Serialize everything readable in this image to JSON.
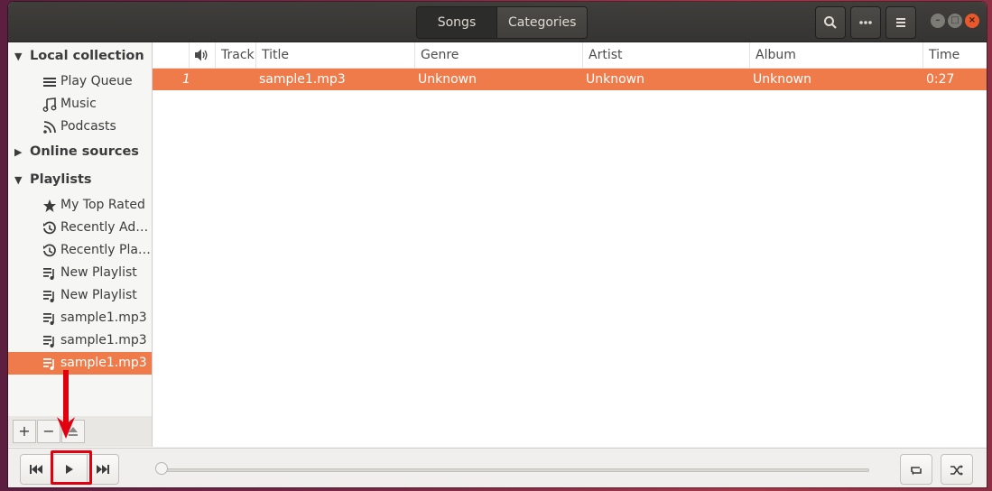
{
  "header": {
    "view_tabs": [
      "Songs",
      "Categories"
    ],
    "active_tab": "Songs"
  },
  "sidebar": {
    "sections": [
      {
        "label": "Local collection",
        "expanded": true,
        "items": [
          {
            "label": "Play Queue",
            "icon": "list-icon"
          },
          {
            "label": "Music",
            "icon": "music-note-icon"
          },
          {
            "label": "Podcasts",
            "icon": "rss-feed-icon"
          }
        ]
      },
      {
        "label": "Online sources",
        "expanded": false,
        "items": []
      },
      {
        "label": "Playlists",
        "expanded": true,
        "items": [
          {
            "label": "My Top Rated",
            "icon": "star-icon"
          },
          {
            "label": "Recently Ad…",
            "icon": "history-icon"
          },
          {
            "label": "Recently Pla…",
            "icon": "history-icon"
          },
          {
            "label": "New Playlist",
            "icon": "playlist-icon"
          },
          {
            "label": "New Playlist",
            "icon": "playlist-icon"
          },
          {
            "label": "sample1.mp3",
            "icon": "playlist-icon"
          },
          {
            "label": "sample1.mp3",
            "icon": "playlist-icon"
          },
          {
            "label": "sample1.mp3",
            "icon": "playlist-icon",
            "selected": true
          }
        ]
      }
    ],
    "footer": {
      "add": "+",
      "remove": "−"
    }
  },
  "tracks": {
    "columns": [
      "",
      "Track",
      "Title",
      "Genre",
      "Artist",
      "Album",
      "Time"
    ],
    "rows": [
      {
        "num": "1",
        "track": "",
        "title": "sample1.mp3",
        "genre": "Unknown",
        "artist": "Unknown",
        "album": "Unknown",
        "time": "0:27"
      }
    ]
  },
  "colors": {
    "accent": "#ef7b4b",
    "header": "#3c3b37",
    "annotation": "#e00010"
  }
}
